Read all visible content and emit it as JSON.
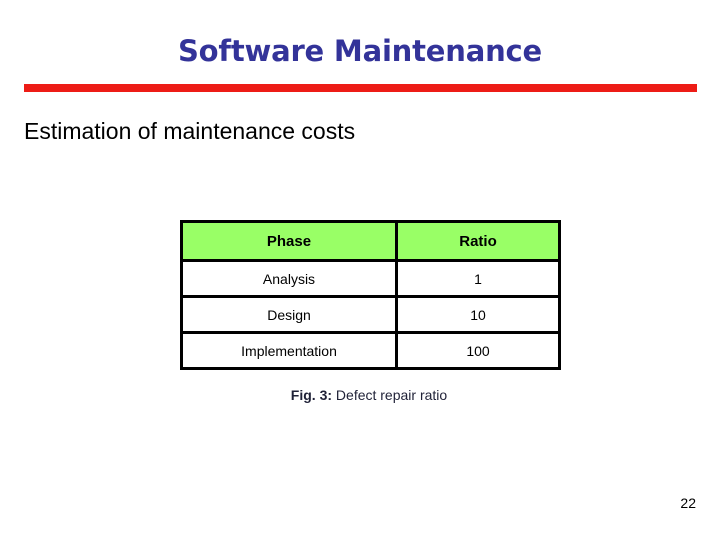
{
  "slide": {
    "title": "Software Maintenance",
    "subtitle": "Estimation of maintenance costs",
    "page_number": "22",
    "accent_rule_color": "#ED1C16",
    "title_color": "#333399",
    "table_header_color": "#99FF66"
  },
  "table": {
    "columns": [
      "Phase",
      "Ratio"
    ],
    "rows": [
      {
        "phase": "Analysis",
        "ratio": "1"
      },
      {
        "phase": "Design",
        "ratio": "10"
      },
      {
        "phase": "Implementation",
        "ratio": "100"
      }
    ]
  },
  "caption": {
    "label": "Fig. 3:",
    "text": " Defect repair ratio"
  }
}
